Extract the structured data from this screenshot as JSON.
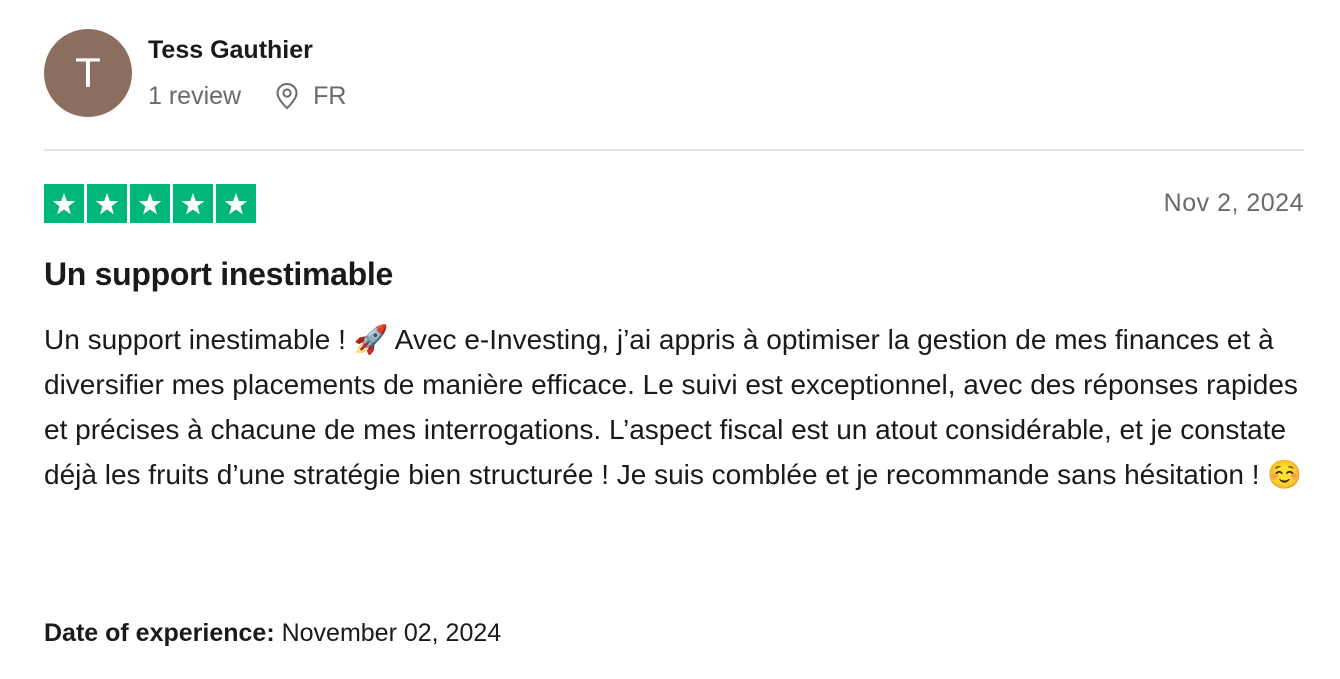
{
  "consumer": {
    "avatar_initial": "T",
    "avatar_color": "#8c6e61",
    "name": "Tess Gauthier",
    "review_count": "1 review",
    "location_icon": "location-pin-icon",
    "country": "FR"
  },
  "rating": {
    "stars": 5,
    "max_stars": 5,
    "star_color": "#00b67a",
    "star_icon": "star-icon"
  },
  "review": {
    "date": "Nov 2, 2024",
    "title": "Un support inestimable",
    "body": "Un support inestimable ! 🚀 Avec e-Investing, j’ai appris à optimiser la gestion de mes finances et à diversifier mes placements de manière efficace. Le suivi est exceptionnel, avec des réponses rapides et précises à chacune de mes interrogations. L’aspect fiscal est un atout considérable, et je constate déjà les fruits d’une stratégie bien structurée ! Je suis comblée et je recommande sans hésitation ! ☺️",
    "experience_label": "Date of experience:",
    "experience_date": "November 02, 2024"
  }
}
